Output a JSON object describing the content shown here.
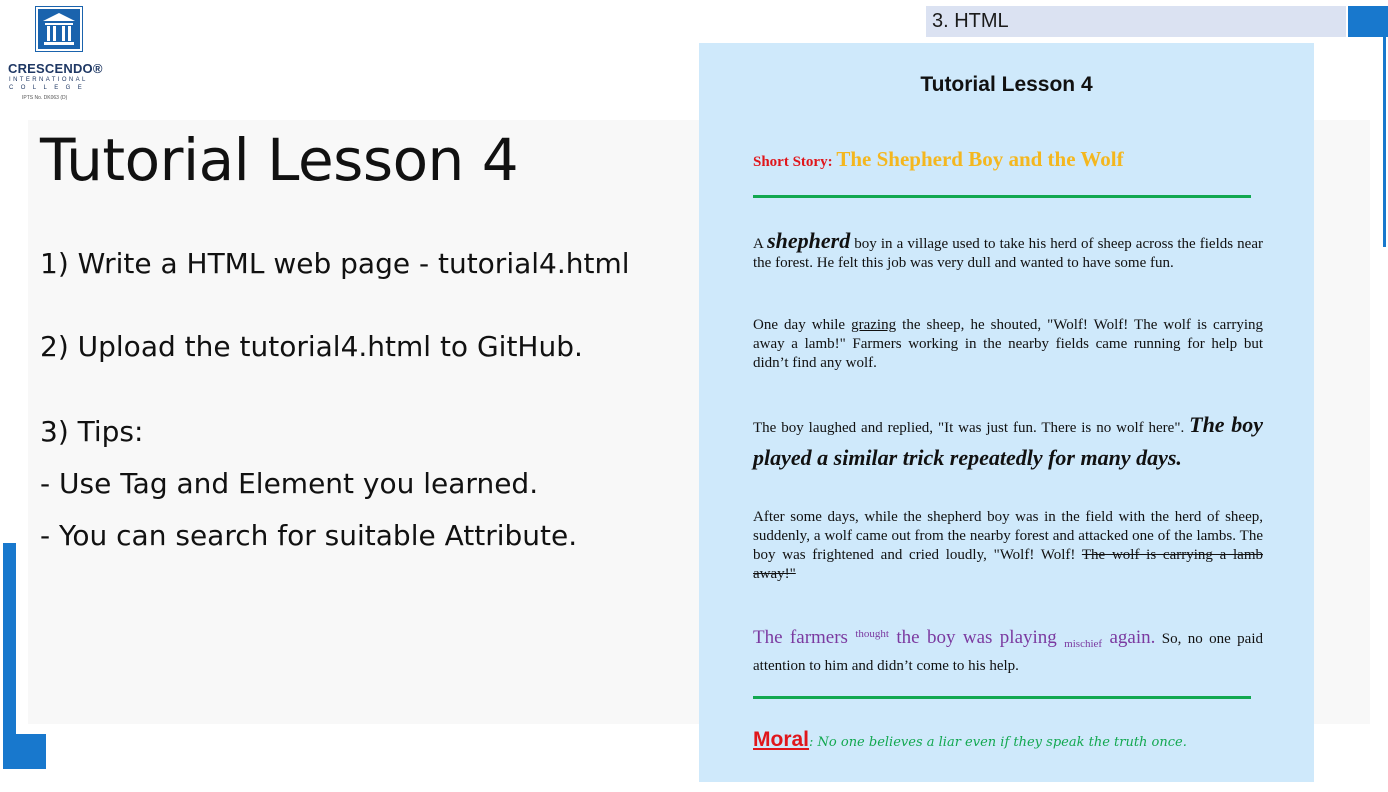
{
  "logo": {
    "name": "CRESCENDO®",
    "sub1": "INTERNATIONAL",
    "sub2": "COLLEGE",
    "reg": "IPTS No. DK063 (D)"
  },
  "section_tag": "3. HTML",
  "slide": {
    "title": "Tutorial Lesson 4",
    "steps": [
      "1) Write a HTML web page - tutorial4.html",
      "2) Upload the tutorial4.html to GitHub.",
      "3) Tips:",
      "- Use Tag and Element you learned.",
      "- You can search for suitable Attribute."
    ]
  },
  "preview": {
    "heading": "Tutorial Lesson 4",
    "story_label": "Short Story:",
    "story_title": "The Shepherd Boy and the Wolf",
    "p1": {
      "a": "A ",
      "bold": "shepherd",
      "rest": " boy in a village used to take his herd of sheep across the fields near the forest. He felt this job was very dull and wanted to have some fun."
    },
    "p2": {
      "a": "One day while ",
      "u": "grazing",
      "rest": " the sheep, he shouted, \"Wolf! Wolf! The wolf is carrying away a lamb!\" Farmers working in the nearby fields came running for help but didn’t find any wolf."
    },
    "p3": {
      "a": "The boy laughed and replied, \"It was just fun. There is no wolf here\". ",
      "bold": "The boy played a similar trick repeatedly for many days."
    },
    "p4": {
      "a": "After some days, while the shepherd boy was in the field with the herd of sheep, suddenly, a wolf came out from the nearby forest and attacked one of the lambs. The boy was frightened and cried loudly, \"Wolf! Wolf! ",
      "strike": "The wolf is carrying a lamb away!\""
    },
    "p5": {
      "a": "The farmers ",
      "sup": "thought",
      "b": " the boy was playing ",
      "sub": "mischief",
      "c": " again.",
      "rest": " So, no one paid attention to him and didn’t come to his help."
    },
    "moral_label": "Moral",
    "moral_text": ": No one believes a liar even if they speak the truth once."
  },
  "colors": {
    "accent_blue": "#1878cd",
    "preview_bg": "#cfe9fb",
    "red": "#e0161b",
    "gold": "#f4b71f",
    "green": "#12a850",
    "purple": "#7b3aa0"
  }
}
